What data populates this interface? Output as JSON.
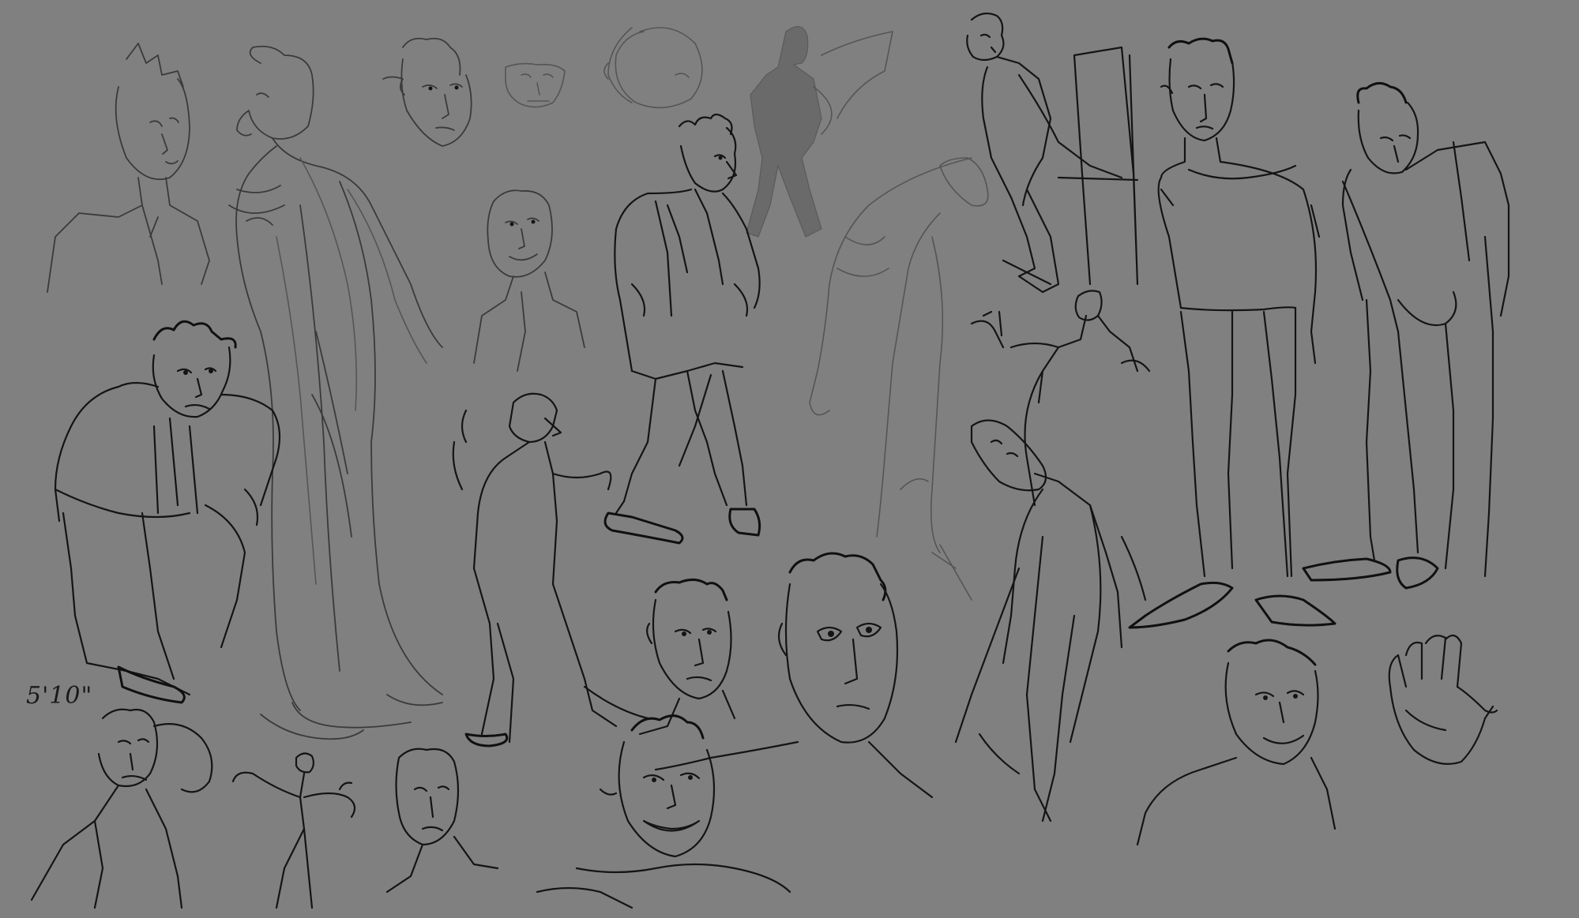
{
  "canvas": {
    "background_color": "#808080",
    "ink_color": "#141414",
    "pencil_color": "#3a3a3a"
  },
  "annotations": {
    "height_note": "5'10\""
  }
}
